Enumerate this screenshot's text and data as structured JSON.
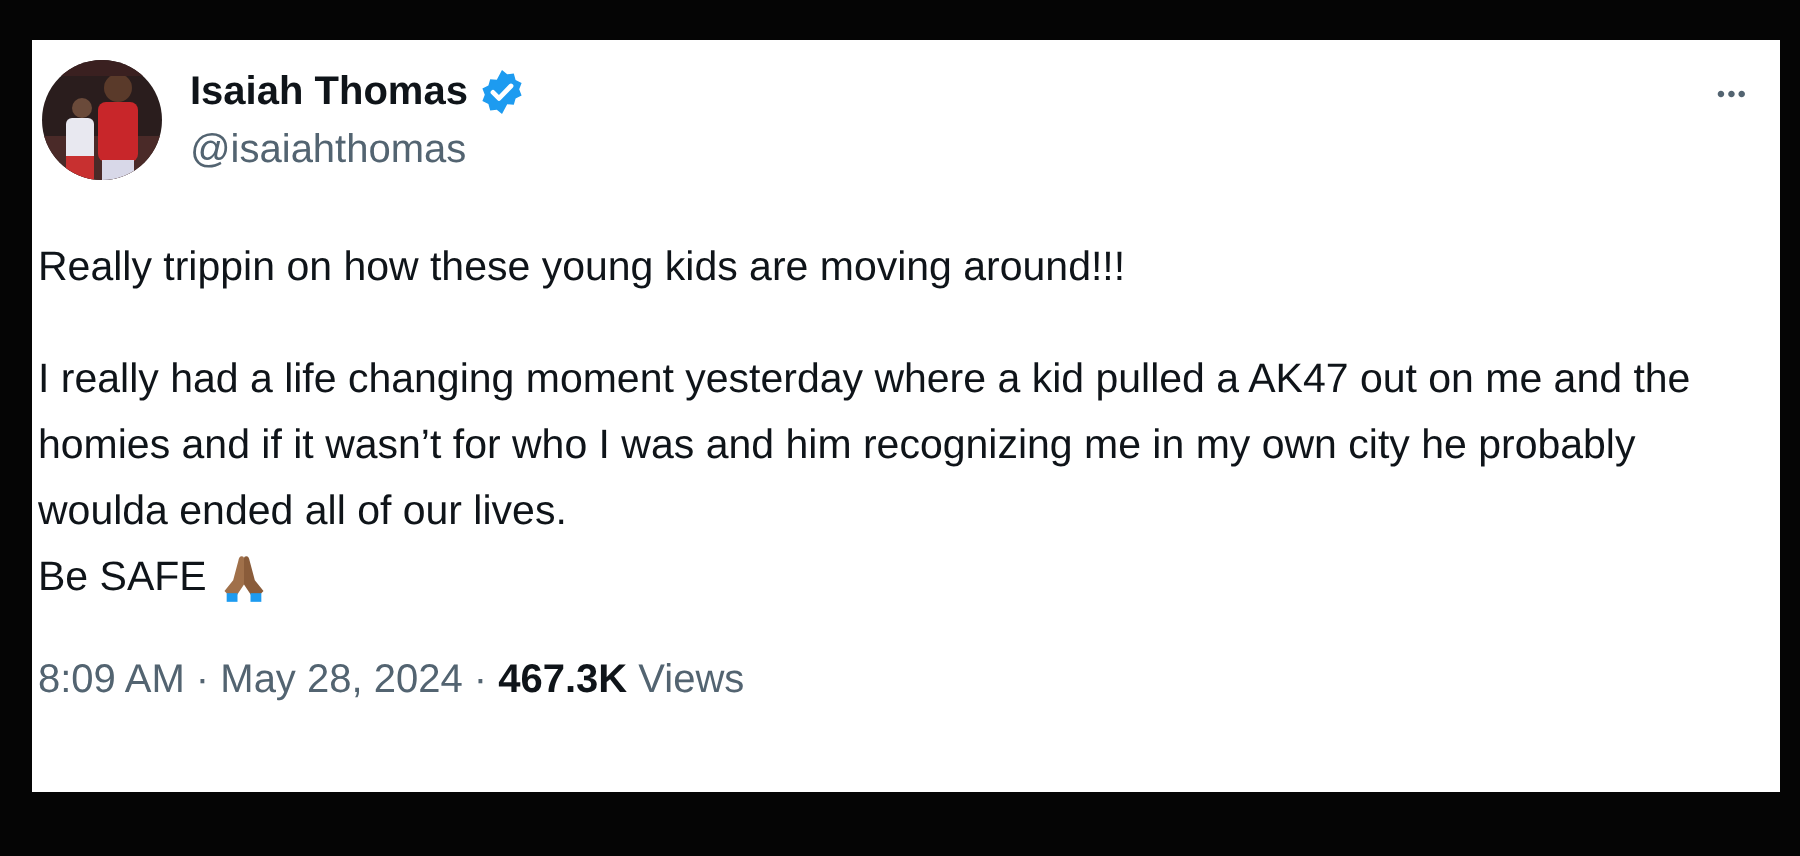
{
  "author": {
    "name": "Isaiah Thomas",
    "handle": "@isaiahthomas",
    "verified": true
  },
  "more_button": "•••",
  "paragraphs": [
    "Really trippin on how these young kids are moving around!!!",
    "I really had a life changing moment yesterday where a kid pulled a AK47 out on me and the homies and if it wasn’t for who I was and him recognizing me in my own city he probably woulda ended all of our lives."
  ],
  "closing": "Be SAFE",
  "meta": "8:09 AM · May 28, 2024 · **467.3K** Views"
}
